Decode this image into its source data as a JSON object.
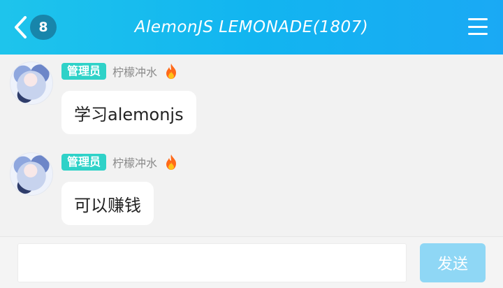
{
  "header": {
    "title": "AlemonJS LEMONADE(1807)",
    "unread_count": "8",
    "back_icon": "chevron-left-icon",
    "menu_icon": "hamburger-menu-icon"
  },
  "messages": [
    {
      "role": "管理员",
      "nickname": "柠檬冲水",
      "text": "学习alemonjs",
      "level_icon": "fire-icon"
    },
    {
      "role": "管理员",
      "nickname": "柠檬冲水",
      "text": "可以赚钱",
      "level_icon": "fire-icon"
    }
  ],
  "composer": {
    "value": "",
    "send_label": "发送"
  },
  "colors": {
    "header": "#12b5f0",
    "role_badge": "#2fd2c8",
    "send_button": "#8fd7f5"
  }
}
